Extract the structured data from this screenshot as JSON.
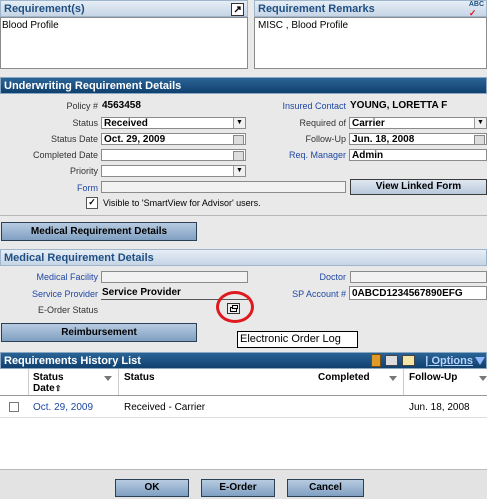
{
  "requirement": {
    "header": "Requirement(s)",
    "value": "Blood Profile"
  },
  "remarks": {
    "header": "Requirement Remarks",
    "value": "MISC , Blood Profile",
    "spell_label": "ABC"
  },
  "underwriting": {
    "header": "Underwriting Requirement Details",
    "policy_label": "Policy #",
    "policy_value": "4563458",
    "insured_label": "Insured Contact",
    "insured_value": "YOUNG, LORETTA F",
    "status_label": "Status",
    "status_value": "Received",
    "required_of_label": "Required of",
    "required_of_value": "Carrier",
    "status_date_label": "Status Date",
    "status_date_value": "Oct. 29, 2009",
    "followup_label": "Follow-Up",
    "followup_value": "Jun. 18, 2008",
    "completed_date_label": "Completed Date",
    "completed_date_value": "",
    "req_manager_label": "Req. Manager",
    "req_manager_value": "Admin",
    "priority_label": "Priority",
    "priority_value": "",
    "form_label": "Form",
    "form_value": "",
    "view_linked_form": "View Linked Form",
    "visible_checkbox_label": "Visible to 'SmartView for Advisor' users."
  },
  "medical_details_button": "Medical Requirement Details",
  "medical": {
    "header": "Medical Requirement Details",
    "facility_label": "Medical Facility",
    "facility_value": "",
    "doctor_label": "Doctor",
    "doctor_value": "",
    "provider_label": "Service Provider",
    "provider_value": "Service Provider",
    "sp_account_label": "SP Account #",
    "sp_account_value": "0ABCD1234567890EFG",
    "eorder_status_label": "E-Order Status",
    "tooltip": "Electronic Order Log"
  },
  "reimbursement_button": "Reimbursement",
  "history": {
    "header": "Requirements History List",
    "options_label": "Options",
    "columns": [
      "Status Date",
      "Status",
      "Completed",
      "Follow-Up"
    ],
    "status_date_line1": "Status",
    "status_date_line2": "Date",
    "rows": [
      {
        "status_date": "Oct. 29, 2009",
        "status": "Received - Carrier",
        "completed": "",
        "followup": "Jun. 18, 2008"
      }
    ]
  },
  "footer": {
    "ok": "OK",
    "eorder": "E-Order",
    "cancel": "Cancel"
  },
  "colors": {
    "header_blue": "#1c5287",
    "highlight_red": "#e0191f",
    "link_blue": "#1f47a3"
  }
}
